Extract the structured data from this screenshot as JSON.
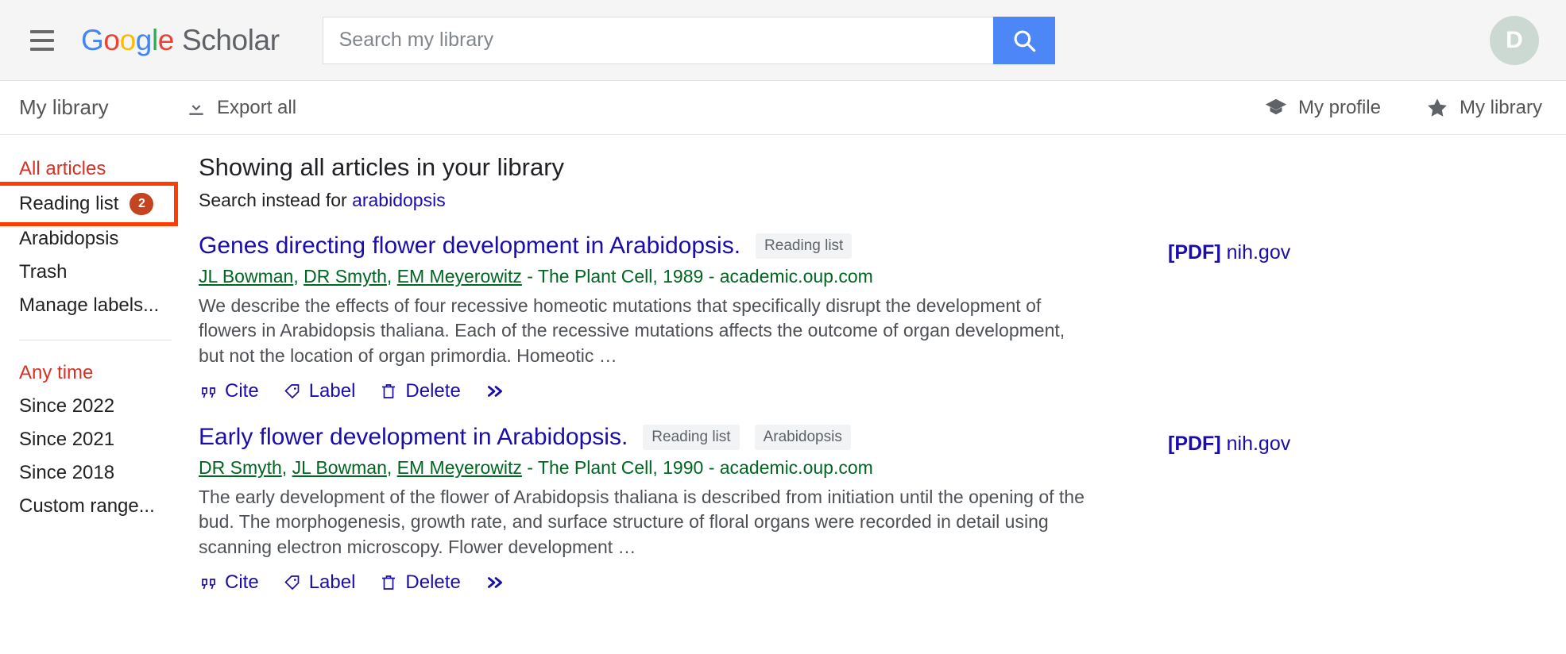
{
  "header": {
    "menu_icon": "hamburger-icon",
    "brand": {
      "google": "Google",
      "scholar": "Scholar"
    },
    "search": {
      "value": "",
      "placeholder": "Search my library",
      "button_icon": "search-icon"
    },
    "avatar_initial": "D",
    "accent_blue": "#4d86f7"
  },
  "toolbar": {
    "title": "My library",
    "export_all": "Export all",
    "export_icon": "download-icon",
    "my_profile": "My profile",
    "profile_icon": "graduation-cap-icon",
    "my_library": "My library",
    "library_icon": "star-icon"
  },
  "sidebar": {
    "labels": [
      {
        "text": "All articles",
        "accent": true,
        "badge": null
      },
      {
        "text": "Reading list",
        "accent": false,
        "badge": "2",
        "highlighted": true
      },
      {
        "text": "Arabidopsis",
        "accent": false,
        "badge": null
      },
      {
        "text": "Trash",
        "accent": false,
        "badge": null
      },
      {
        "text": "Manage labels...",
        "accent": false,
        "badge": null
      }
    ],
    "time_filters": [
      {
        "text": "Any time",
        "accent": true
      },
      {
        "text": "Since 2022",
        "accent": false
      },
      {
        "text": "Since 2021",
        "accent": false
      },
      {
        "text": "Since 2018",
        "accent": false
      },
      {
        "text": "Custom range...",
        "accent": false
      }
    ],
    "highlight_color": "#ff3d00",
    "badge_color": "#c5441f",
    "accent_color": "#d93025"
  },
  "main": {
    "showing": "Showing all articles in your library",
    "search_instead_prefix": "Search instead for ",
    "search_instead_term": "arabidopsis",
    "results": [
      {
        "title": "Genes directing flower development in Arabidopsis.",
        "tags": [
          "Reading list"
        ],
        "authors": [
          "JL Bowman",
          "DR Smyth",
          "EM Meyerowitz"
        ],
        "venue": " - The Plant Cell, 1989 - academic.oup.com",
        "snippet": "We describe the effects of four recessive homeotic mutations that specifically disrupt the development of flowers in Arabidopsis thaliana. Each of the recessive mutations affects the outcome of organ development, but not the location of organ primordia. Homeotic …",
        "actions": [
          {
            "label": "Cite",
            "icon": "quote-icon"
          },
          {
            "label": "Label",
            "icon": "tag-icon"
          },
          {
            "label": "Delete",
            "icon": "trash-icon"
          },
          {
            "label": "",
            "icon": "double-chevron-right-icon"
          }
        ],
        "pdf_badge": "[PDF]",
        "pdf_source": "nih.gov"
      },
      {
        "title": "Early flower development in Arabidopsis.",
        "tags": [
          "Reading list",
          "Arabidopsis"
        ],
        "authors": [
          "DR Smyth",
          "JL Bowman",
          "EM Meyerowitz"
        ],
        "venue": " - The Plant Cell, 1990 - academic.oup.com",
        "snippet": "The early development of the flower of Arabidopsis thaliana is described from initiation until the opening of the bud. The morphogenesis, growth rate, and surface structure of floral organs were recorded in detail using scanning electron microscopy. Flower development …",
        "actions": [
          {
            "label": "Cite",
            "icon": "quote-icon"
          },
          {
            "label": "Label",
            "icon": "tag-icon"
          },
          {
            "label": "Delete",
            "icon": "trash-icon"
          },
          {
            "label": "",
            "icon": "double-chevron-right-icon"
          }
        ],
        "pdf_badge": "[PDF]",
        "pdf_source": "nih.gov"
      }
    ]
  }
}
